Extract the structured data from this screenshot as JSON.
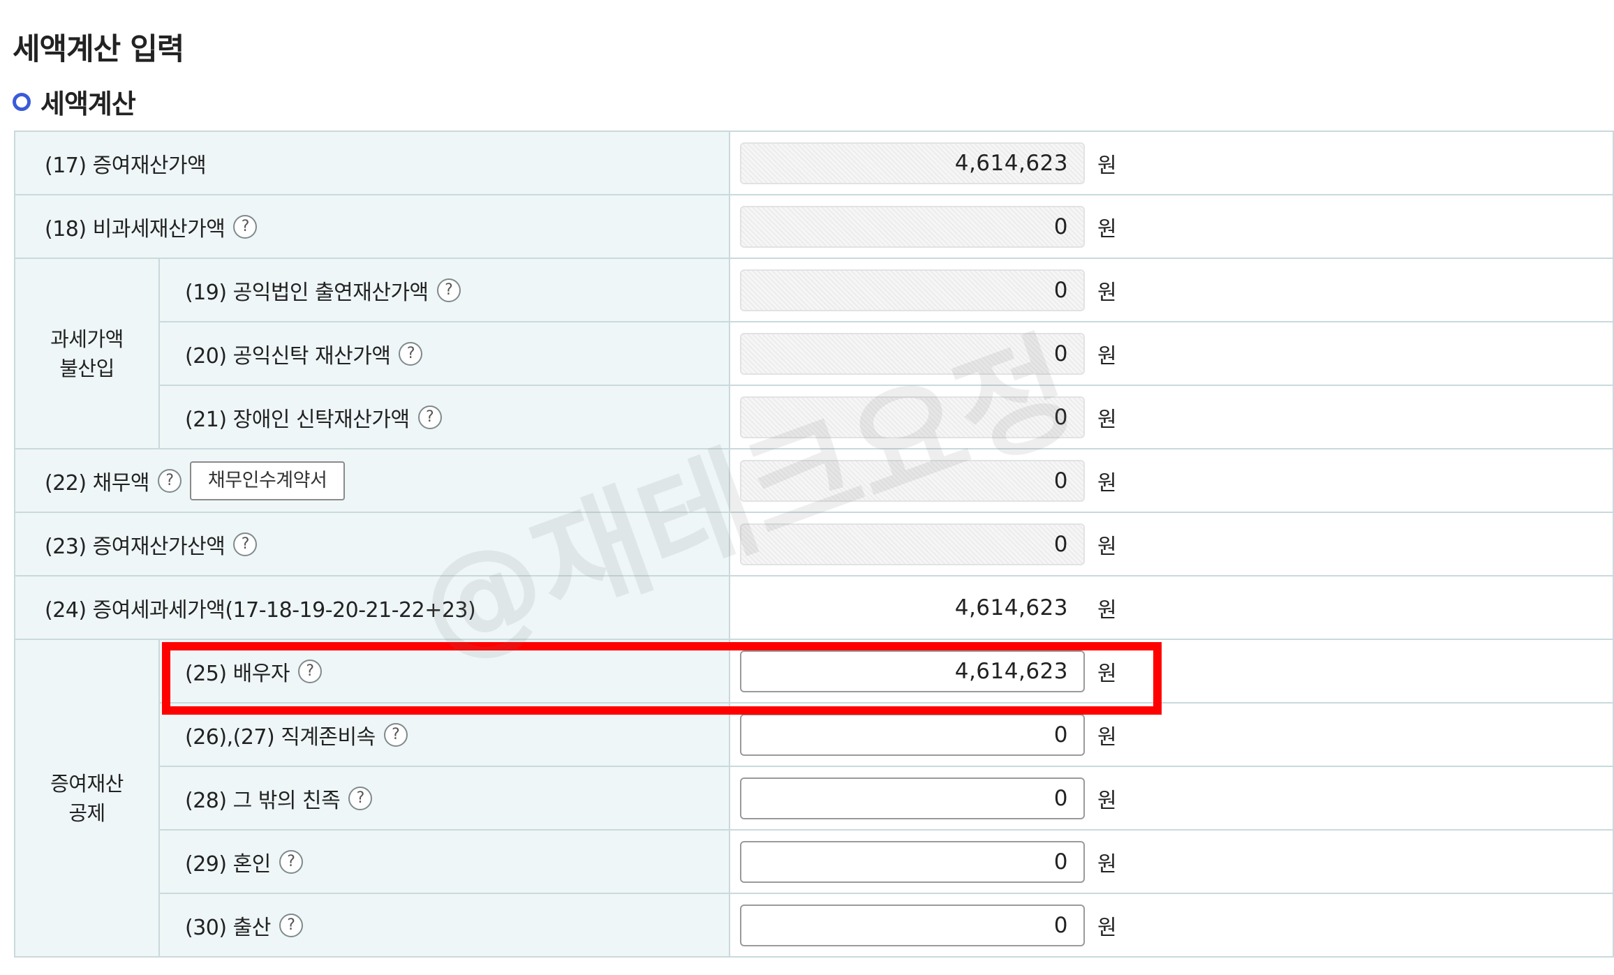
{
  "page_title": "세액계산 입력",
  "section_title": "세액계산",
  "unit": "원",
  "help_symbol": "?",
  "rows": {
    "r17": {
      "label": "(17) 증여재산가액",
      "value": "4,614,623"
    },
    "r18": {
      "label": "(18) 비과세재산가액",
      "value": "0"
    },
    "r19": {
      "label": "(19) 공익법인 출연재산가액",
      "value": "0"
    },
    "r20": {
      "label": "(20) 공익신탁 재산가액",
      "value": "0"
    },
    "r21": {
      "label": "(21) 장애인 신탁재산가액",
      "value": "0"
    },
    "r22": {
      "label": "(22) 채무액",
      "value": "0",
      "button": "채무인수계약서"
    },
    "r23": {
      "label": "(23) 증여재산가산액",
      "value": "0"
    },
    "r24": {
      "label": "(24) 증여세과세가액(17-18-19-20-21-22+23)",
      "value": "4,614,623"
    },
    "r25": {
      "label": "(25) 배우자",
      "value": "4,614,623"
    },
    "r26": {
      "label": "(26),(27) 직계존비속",
      "value": "0"
    },
    "r28": {
      "label": "(28) 그 밖의 친족",
      "value": "0"
    },
    "r29": {
      "label": "(29) 혼인",
      "value": "0"
    },
    "r30": {
      "label": "(30) 출산",
      "value": "0"
    }
  },
  "groups": {
    "exclusion": {
      "line1": "과세가액",
      "line2": "불산입"
    },
    "deduction": {
      "line1": "증여재산",
      "line2": "공제"
    }
  },
  "watermark": "@재테크요정",
  "colors": {
    "label_bg": "#eef6f7",
    "border": "#c9dadc",
    "bullet": "#3a5bd9",
    "highlight": "#ff0000"
  }
}
